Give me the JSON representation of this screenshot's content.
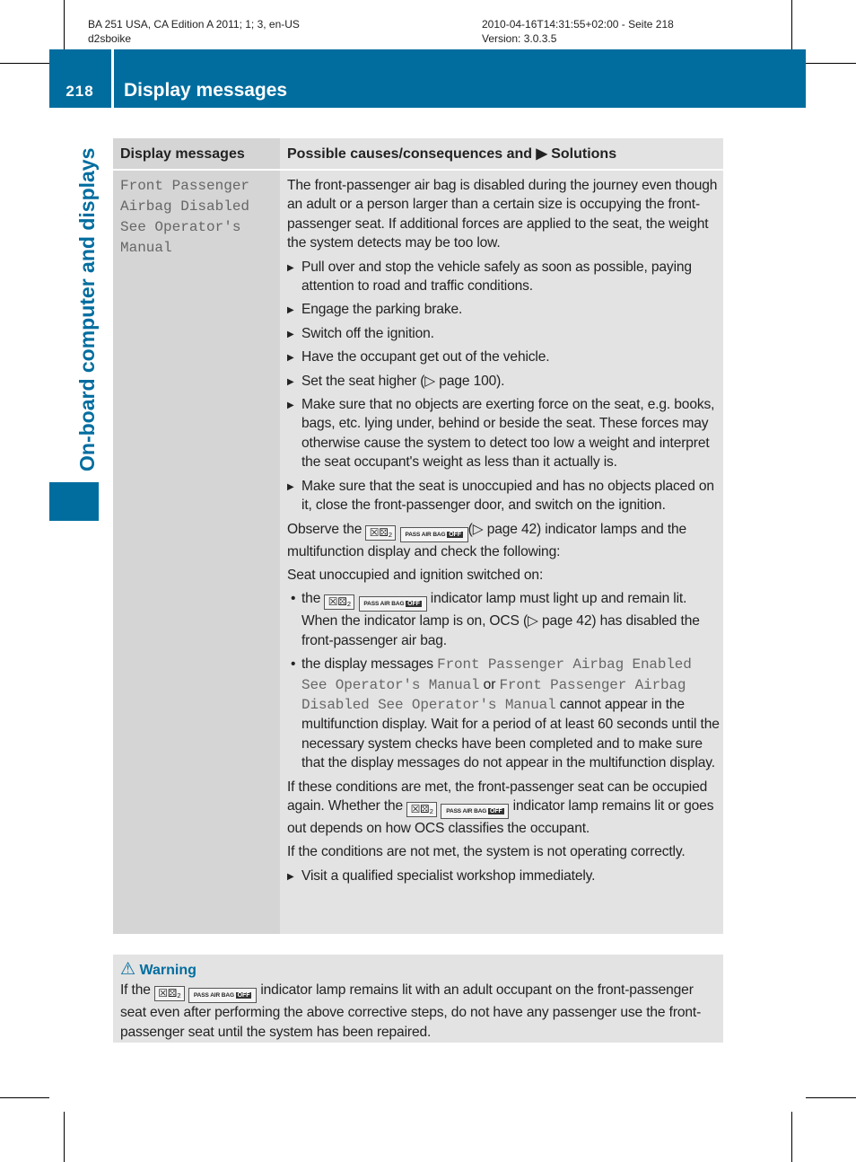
{
  "header": {
    "left_line1": "BA 251 USA, CA Edition A 2011; 1; 3, en-US",
    "left_line2": "d2sboike",
    "right_line1": "2010-04-16T14:31:55+02:00 - Seite 218",
    "right_line2": "Version: 3.0.3.5"
  },
  "page": {
    "number": "218",
    "title": "Display messages",
    "side_tab": "On-board computer and displays",
    "accent": "#016d9f"
  },
  "icons": {
    "seat": "seat-occupant-icon",
    "seat_glyph": "☒⚄₂",
    "pab_text": "PASS AIR BAG",
    "pab_off": "OFF"
  },
  "table": {
    "col1": "Display messages",
    "col2_a": "Possible causes/consequences and",
    "col2_b": "Solutions",
    "message": "Front Passenger\nAirbag Disabled\nSee Operator's\nManual",
    "p1": "The front-passenger air bag is disabled during the journey even though an adult or a person larger than a certain size is occupying the front-passenger seat. If additional forces are applied to the seat, the weight the system detects may be too low.",
    "steps": [
      "Pull over and stop the vehicle safely as soon as possible, paying attention to road and traffic conditions.",
      "Engage the parking brake.",
      "Switch off the ignition.",
      "Have the occupant get out of the vehicle.",
      "Set the seat higher (▷ page 100).",
      "Make sure that no objects are exerting force on the seat, e.g. books, bags, etc. lying under, behind or beside the seat. These forces may otherwise cause the system to detect too low a weight and interpret the seat occupant's weight as less than it actually is.",
      "Make sure that the seat is unoccupied and has no objects placed on it, close the front-passenger door, and switch on the ignition."
    ],
    "observe_a": "Observe the",
    "observe_b": "(▷ page 42) indicator lamps and the multifunction display and check the following:",
    "seat_unocc": "Seat unoccupied and ignition switched on:",
    "b1_a": "the",
    "b1_b": "indicator lamp must light up and remain lit. When the indicator lamp is on, OCS (▷ page 42) has disabled the front-passenger air bag.",
    "b2_a": "the display messages",
    "b2_m1": "Front Passenger Airbag Enabled See Operator's Manual",
    "b2_or": "or",
    "b2_m2": "Front Passenger Airbag Disabled See Operator's Manual",
    "b2_b": "cannot appear in the multifunction display. Wait for a period of at least 60 seconds until the necessary system checks have been completed and to make sure that the display messages do not appear in the multifunction display.",
    "met_a": "If these conditions are met, the front-passenger seat can be occupied again. Whether the",
    "met_b": "indicator lamp remains lit or goes out depends on how OCS classifies the occupant.",
    "notmet": "If the conditions are not met, the system is not operating correctly.",
    "final_step": "Visit a qualified specialist workshop immediately."
  },
  "warning": {
    "title": "Warning",
    "a": "If the",
    "b": "indicator lamp remains lit with an adult occupant on the front-passenger seat even after performing the above corrective steps, do not have any passenger use the front-passenger seat until the system has been repaired."
  }
}
